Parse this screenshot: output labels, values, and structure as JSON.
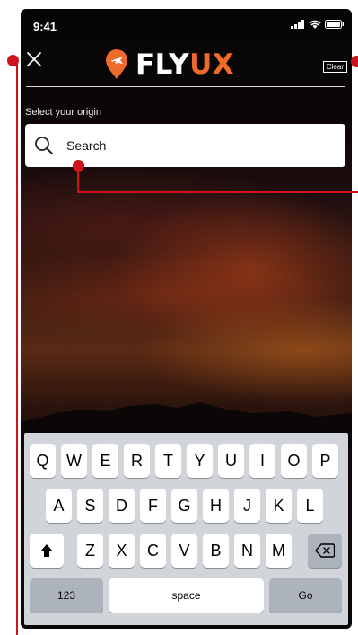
{
  "status_bar": {
    "time": "9:41"
  },
  "header": {
    "logo_part1": "FLY",
    "logo_part2": "UX",
    "clear_label": "Clear"
  },
  "origin": {
    "label": "Select your origin",
    "search_placeholder": "Search"
  },
  "keyboard": {
    "row1": [
      "Q",
      "W",
      "E",
      "R",
      "T",
      "Y",
      "U",
      "I",
      "O",
      "P"
    ],
    "row2": [
      "A",
      "S",
      "D",
      "F",
      "G",
      "H",
      "J",
      "K",
      "L"
    ],
    "row3": [
      "Z",
      "X",
      "C",
      "V",
      "B",
      "N",
      "M"
    ],
    "numbers_label": "123",
    "space_label": "space",
    "go_label": "Go"
  },
  "colors": {
    "brand_orange": "#ef6a2b",
    "annotation_red": "#d0121c",
    "keyboard_bg": "#d1d4d9"
  },
  "icons": [
    "close-icon",
    "plane-pin-icon",
    "search-icon",
    "shift-icon",
    "backspace-icon",
    "signal-icon",
    "wifi-icon",
    "battery-icon"
  ]
}
